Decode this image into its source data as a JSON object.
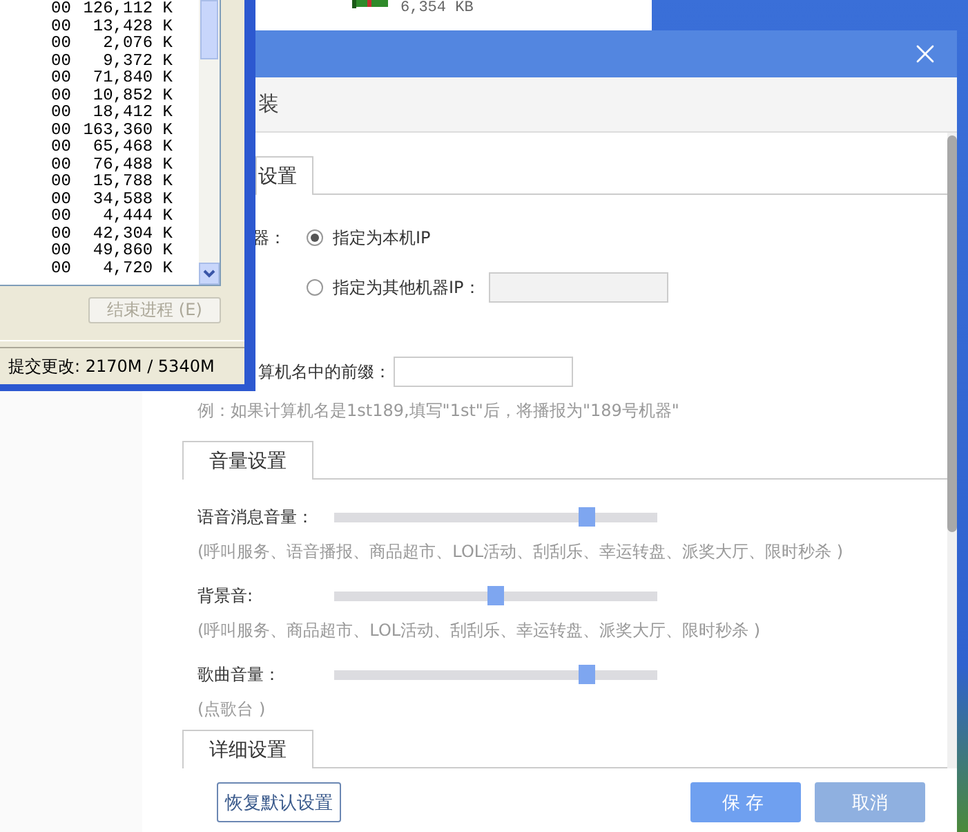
{
  "background_window": {
    "file_size": "6,354 KB"
  },
  "task_manager": {
    "processes": [
      {
        "cpu": "00",
        "memory": "126,112 K"
      },
      {
        "cpu": "00",
        "memory": "13,428 K"
      },
      {
        "cpu": "00",
        "memory": "2,076 K"
      },
      {
        "cpu": "00",
        "memory": "9,372 K"
      },
      {
        "cpu": "00",
        "memory": "71,840 K"
      },
      {
        "cpu": "00",
        "memory": "10,852 K"
      },
      {
        "cpu": "00",
        "memory": "18,412 K"
      },
      {
        "cpu": "00",
        "memory": "163,360 K"
      },
      {
        "cpu": "00",
        "memory": "65,468 K"
      },
      {
        "cpu": "00",
        "memory": "76,488 K"
      },
      {
        "cpu": "00",
        "memory": "15,788 K"
      },
      {
        "cpu": "00",
        "memory": "34,588 K"
      },
      {
        "cpu": "00",
        "memory": "4,444 K"
      },
      {
        "cpu": "00",
        "memory": "42,304 K"
      },
      {
        "cpu": "00",
        "memory": "49,860 K"
      },
      {
        "cpu": "00",
        "memory": "4,720 K"
      }
    ],
    "end_process_button": {
      "label": "结束进程 (E)",
      "disabled": true
    },
    "status_bar": "提交更改: 2170M / 5340M"
  },
  "dialog": {
    "tab_strip": {
      "label": "装"
    },
    "network_tab": {
      "label": "设置"
    },
    "ip_label": "器：",
    "ip_options": [
      {
        "label": "指定为本机IP",
        "selected": true,
        "kind": "plain"
      },
      {
        "label": "指定为其他机器IP：",
        "selected": false,
        "kind": "with_field"
      }
    ],
    "prefix": {
      "label": "算机名中的前缀：",
      "hint": "例：如果计算机名是1st189,填写\"1st\"后，将播报为\"189号机器\""
    },
    "volume_tab": {
      "label": "音量设置"
    },
    "sliders": [
      {
        "label": "语音消息音量：",
        "level": 0.78,
        "hint": "(呼叫服务、语音播报、商品超市、LOL活动、刮刮乐、幸运转盘、派奖大厅、限时秒杀 )"
      },
      {
        "label": "背景音:",
        "level": 0.5,
        "hint": "(呼叫服务、商品超市、LOL活动、刮刮乐、幸运转盘、派奖大厅、限时秒杀 )"
      },
      {
        "label": "歌曲音量：",
        "level": 0.78,
        "hint": "(点歌台 )"
      }
    ],
    "detail_tab": {
      "label": "详细设置"
    },
    "buttons": [
      {
        "label": "恢复默认设置",
        "kind": "outline"
      },
      {
        "label": "保存",
        "kind": "primary"
      },
      {
        "label": "取消",
        "kind": "secondary"
      }
    ]
  }
}
